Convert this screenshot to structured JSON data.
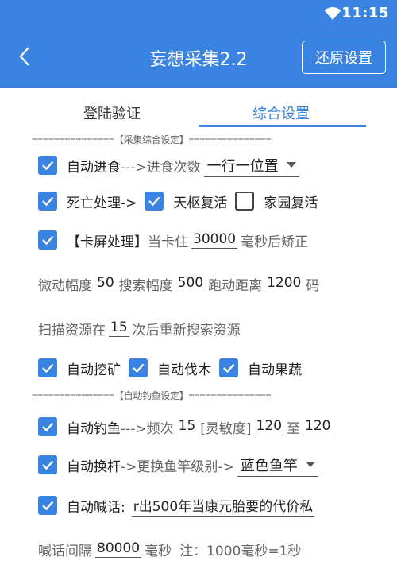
{
  "status": {
    "time": "11:15"
  },
  "appbar": {
    "title": "妄想采集2.2",
    "reset_label": "还原设置"
  },
  "tabs": [
    {
      "label": "登陆验证"
    },
    {
      "label": "综合设置"
    }
  ],
  "sections": {
    "collect_header": "===============【采集综合设定】===============",
    "fish_header": "===============【自动钓鱼设定】==============="
  },
  "rows": {
    "auto_eat": {
      "label": "自动进食",
      "arrow": "--->进食次数",
      "select": "一行一位置"
    },
    "death": {
      "label": "死亡处理->",
      "tianshu": "天枢复活",
      "home": "家园复活"
    },
    "stuck": {
      "label": "【卡屏处理】",
      "text1": "当卡住",
      "value": "30000",
      "text2": "毫秒后矫正"
    },
    "micro": {
      "t1": "微动幅度",
      "v1": "50",
      "t2": "搜索幅度",
      "v2": "500",
      "t3": "跑动距离",
      "v3": "1200",
      "t4": "码"
    },
    "scan": {
      "t1": "扫描资源在",
      "v1": "15",
      "t2": "次后重新搜索资源"
    },
    "gather": {
      "mine": "自动挖矿",
      "wood": "自动伐木",
      "fruit": "自动果蔬"
    },
    "fishing": {
      "label": "自动钓鱼",
      "t1": "--->频次",
      "v1": "15",
      "t2": "[灵敏度]",
      "v2": "120",
      "t3": "至",
      "v3": "120"
    },
    "rod": {
      "label": "自动换杆",
      "t1": "->更换鱼竿级别->",
      "select": "蓝色鱼竿"
    },
    "shout": {
      "label": "自动喊话:",
      "value": "r出500年当康元胎要的代价私"
    },
    "interval": {
      "t1": "喊话间隔",
      "v1": "80000",
      "t2": "毫秒",
      "t3": "注：1000毫秒=1秒"
    }
  }
}
